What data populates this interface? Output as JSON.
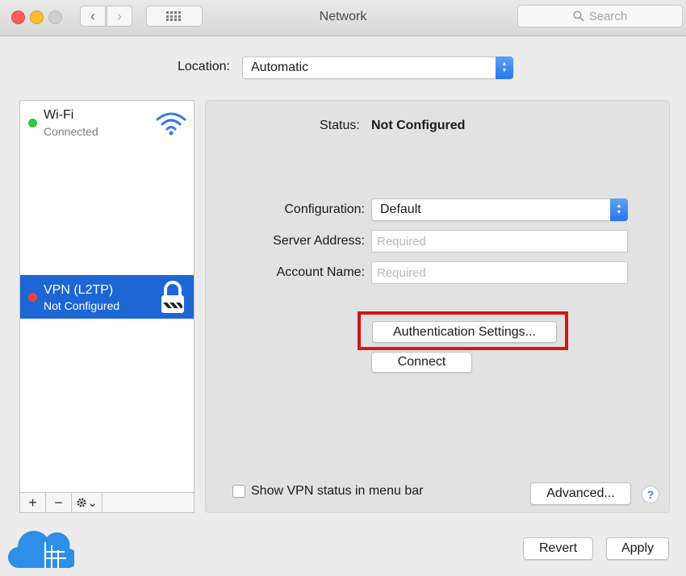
{
  "window": {
    "title": "Network"
  },
  "toolbar": {
    "back_glyph": "‹",
    "forward_glyph": "›",
    "search_placeholder": "Search"
  },
  "location": {
    "label": "Location:",
    "value": "Automatic"
  },
  "services": [
    {
      "name": "Wi-Fi",
      "status": "Connected",
      "status_color": "#2ec840",
      "icon": "wifi-icon",
      "selected": false
    },
    {
      "name": "VPN (L2TP)",
      "status": "Not Configured",
      "status_color": "#f2413a",
      "icon": "lock-icon",
      "selected": true
    }
  ],
  "list_toolbar": {
    "add": "+",
    "remove": "−",
    "gear_caret": "⌄"
  },
  "detail": {
    "status_label": "Status:",
    "status_value": "Not Configured",
    "configuration_label": "Configuration:",
    "configuration_value": "Default",
    "server_label": "Server Address:",
    "server_placeholder": "Required",
    "account_label": "Account Name:",
    "account_placeholder": "Required",
    "auth_button": "Authentication Settings...",
    "connect_button": "Connect",
    "show_status_label": "Show VPN status in menu bar",
    "show_status_checked": false,
    "advanced_button": "Advanced...",
    "help_glyph": "?"
  },
  "footer": {
    "revert": "Revert",
    "apply": "Apply"
  },
  "colors": {
    "selection": "#1c66d5",
    "highlight_box": "#d4151a",
    "accent": "#2a75e9"
  }
}
